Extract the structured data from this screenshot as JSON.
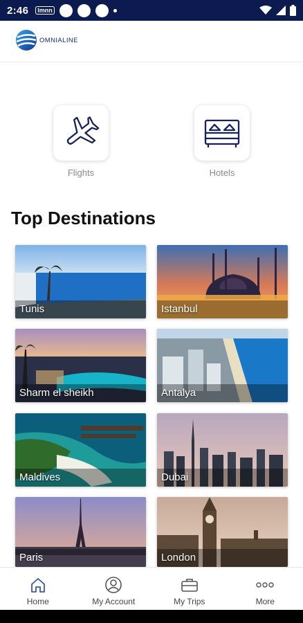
{
  "status_bar": {
    "time": "2:46",
    "notification_tag": "lmnn"
  },
  "header": {
    "logo_text": "OMNIALINE"
  },
  "services": [
    {
      "label": "Flights",
      "icon": "airplane-icon"
    },
    {
      "label": "Hotels",
      "icon": "bed-icon"
    }
  ],
  "destinations_title": "Top Destinations",
  "destinations": [
    {
      "name": "Tunis"
    },
    {
      "name": "Istanbul"
    },
    {
      "name": "Sharm el sheikh"
    },
    {
      "name": "Antalya"
    },
    {
      "name": "Maldives"
    },
    {
      "name": "Dubai"
    },
    {
      "name": "Paris"
    },
    {
      "name": "London"
    }
  ],
  "bottom_nav": [
    {
      "label": "Home",
      "icon": "home-icon"
    },
    {
      "label": "My Account",
      "icon": "account-icon"
    },
    {
      "label": "My Trips",
      "icon": "briefcase-icon"
    },
    {
      "label": "More",
      "icon": "more-icon"
    }
  ],
  "colors": {
    "status_bar": "#0b1a4f",
    "brand": "#0f2f7c",
    "accent": "#1a7dd6"
  }
}
